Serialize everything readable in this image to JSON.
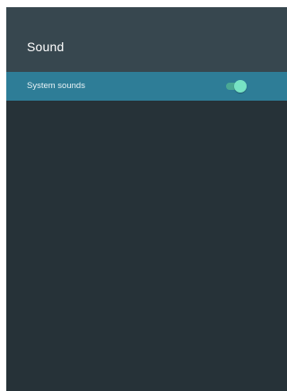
{
  "header": {
    "title": "Sound"
  },
  "settings": {
    "items": [
      {
        "label": "System sounds",
        "toggle_state": "on"
      }
    ]
  },
  "colors": {
    "background": "#263238",
    "header": "#37474f",
    "selected_row": "#2e7d97",
    "toggle_accent": "#77e3c4"
  }
}
